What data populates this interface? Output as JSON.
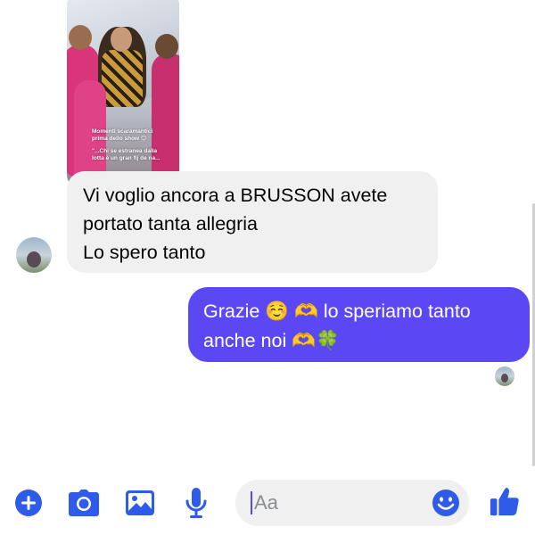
{
  "conversation": {
    "story_preview": {
      "caption_line1": "Momenti scaramantici prima dello show 😊",
      "caption_line2": "\"...Chi se estranea dalla lotta è un gran fij de na..."
    },
    "incoming_message": {
      "lines": [
        "Vi voglio ancora a BRUSSON avete",
        "portato tanta allegria",
        "Lo spero tanto"
      ]
    },
    "outgoing_message": {
      "line1_text_a": "Grazie",
      "line1_emoji_a": "☺️",
      "line1_emoji_b": "🫶",
      "line1_text_b": "lo speriamo tanto",
      "line2_text": "anche noi",
      "line2_emoji_a": "🫶",
      "line2_emoji_b": "🍀"
    }
  },
  "composer": {
    "placeholder": "Aa",
    "icons": [
      "plus-icon",
      "camera-icon",
      "photo-icon",
      "microphone-icon",
      "emoji-icon",
      "thumbs-up-icon"
    ]
  },
  "colors": {
    "accent": "#5a48f5",
    "icon_blue": "#2f5bea",
    "incoming_bubble": "#f0f0f0",
    "outgoing_bubble": "#5a48f5"
  }
}
